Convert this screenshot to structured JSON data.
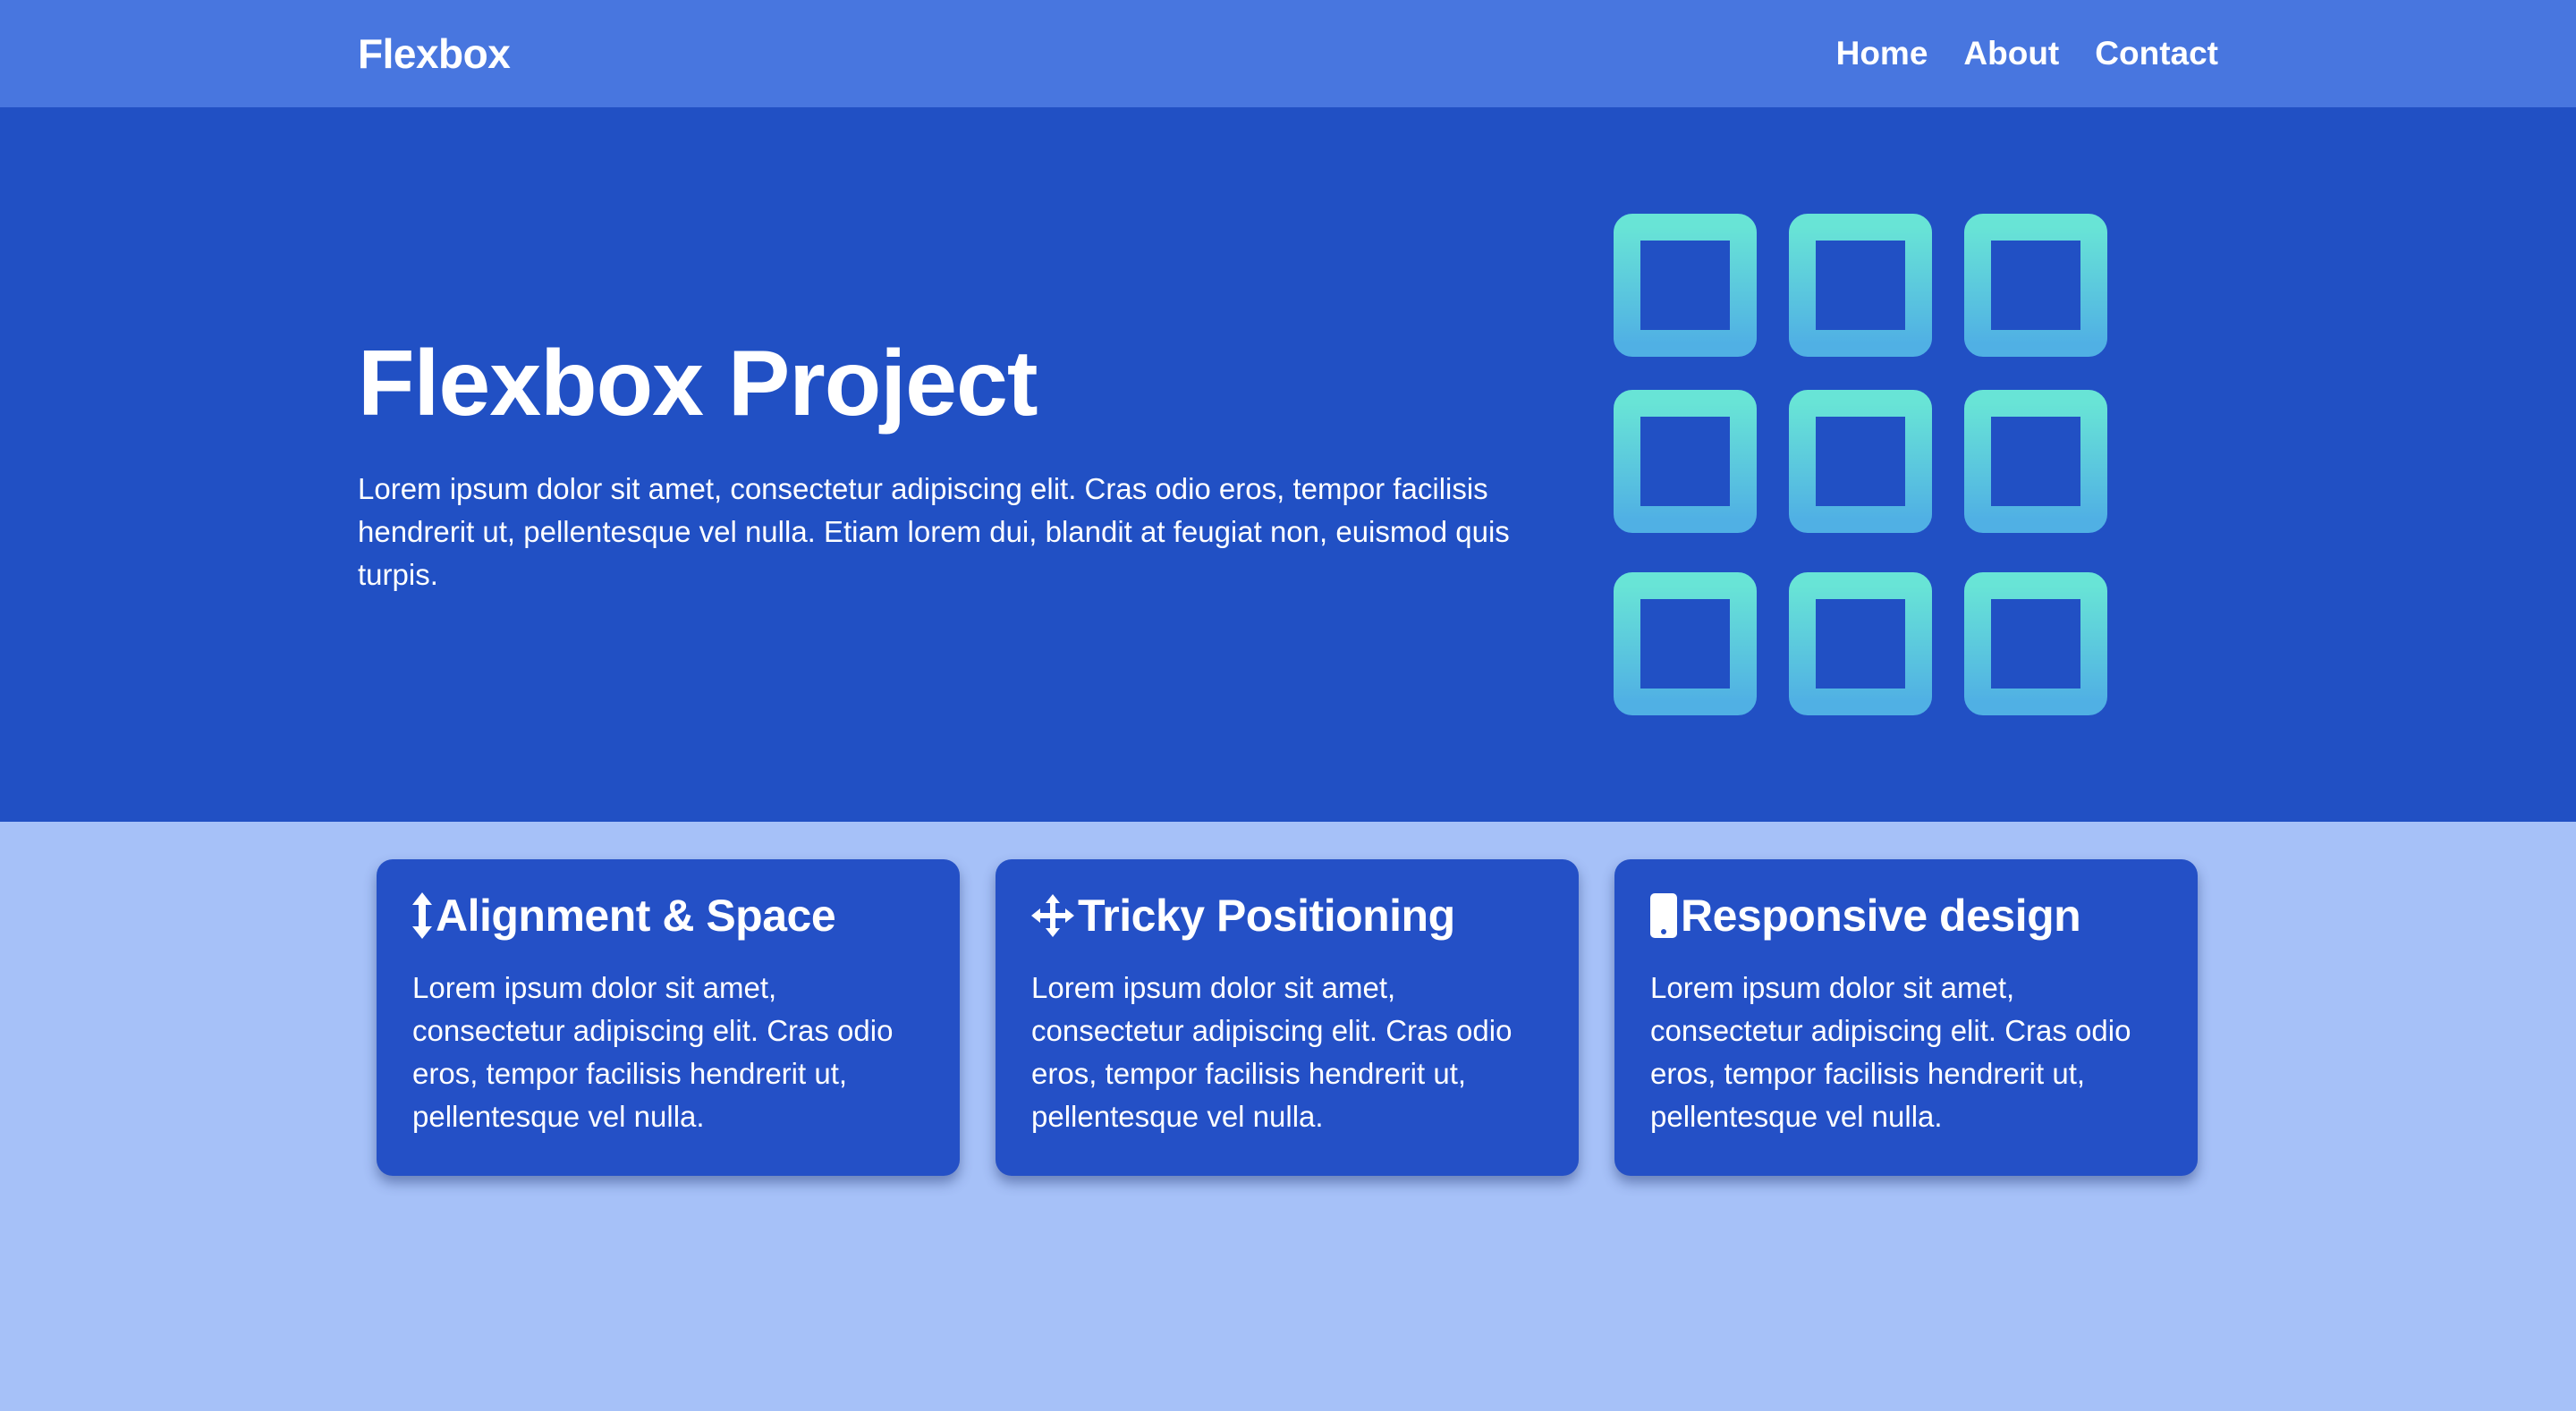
{
  "nav": {
    "brand": "Flexbox",
    "links": [
      "Home",
      "About",
      "Contact"
    ]
  },
  "hero": {
    "title": "Flexbox Project",
    "text": "Lorem ipsum dolor sit amet, consectetur adipiscing elit. Cras odio eros, tempor facilisis hendrerit ut, pellentesque vel nulla. Etiam lorem dui, blandit at feugiat non, euismod quis turpis.",
    "icon": "grid-3x3-icon"
  },
  "cards": [
    {
      "icon": "arrows-vertical-icon",
      "title": "Alignment & Space",
      "text": "Lorem ipsum dolor sit amet, consectetur adipiscing elit. Cras odio eros, tempor facilisis hendrerit ut, pellentesque vel nulla."
    },
    {
      "icon": "arrows-move-icon",
      "title": "Tricky Positioning",
      "text": "Lorem ipsum dolor sit amet, consectetur adipiscing elit. Cras odio eros, tempor facilisis hendrerit ut, pellentesque vel nulla."
    },
    {
      "icon": "mobile-phone-icon",
      "title": "Responsive design",
      "text": "Lorem ipsum dolor sit amet, consectetur adipiscing elit. Cras odio eros, tempor facilisis hendrerit ut, pellentesque vel nulla."
    }
  ],
  "colors": {
    "nav": "#4876df",
    "hero": "#2150c4",
    "page": "#a6c1f8",
    "card": "#2450c6",
    "icon_gradient_top": "#68e4d6",
    "icon_gradient_bottom": "#50b0e4"
  }
}
